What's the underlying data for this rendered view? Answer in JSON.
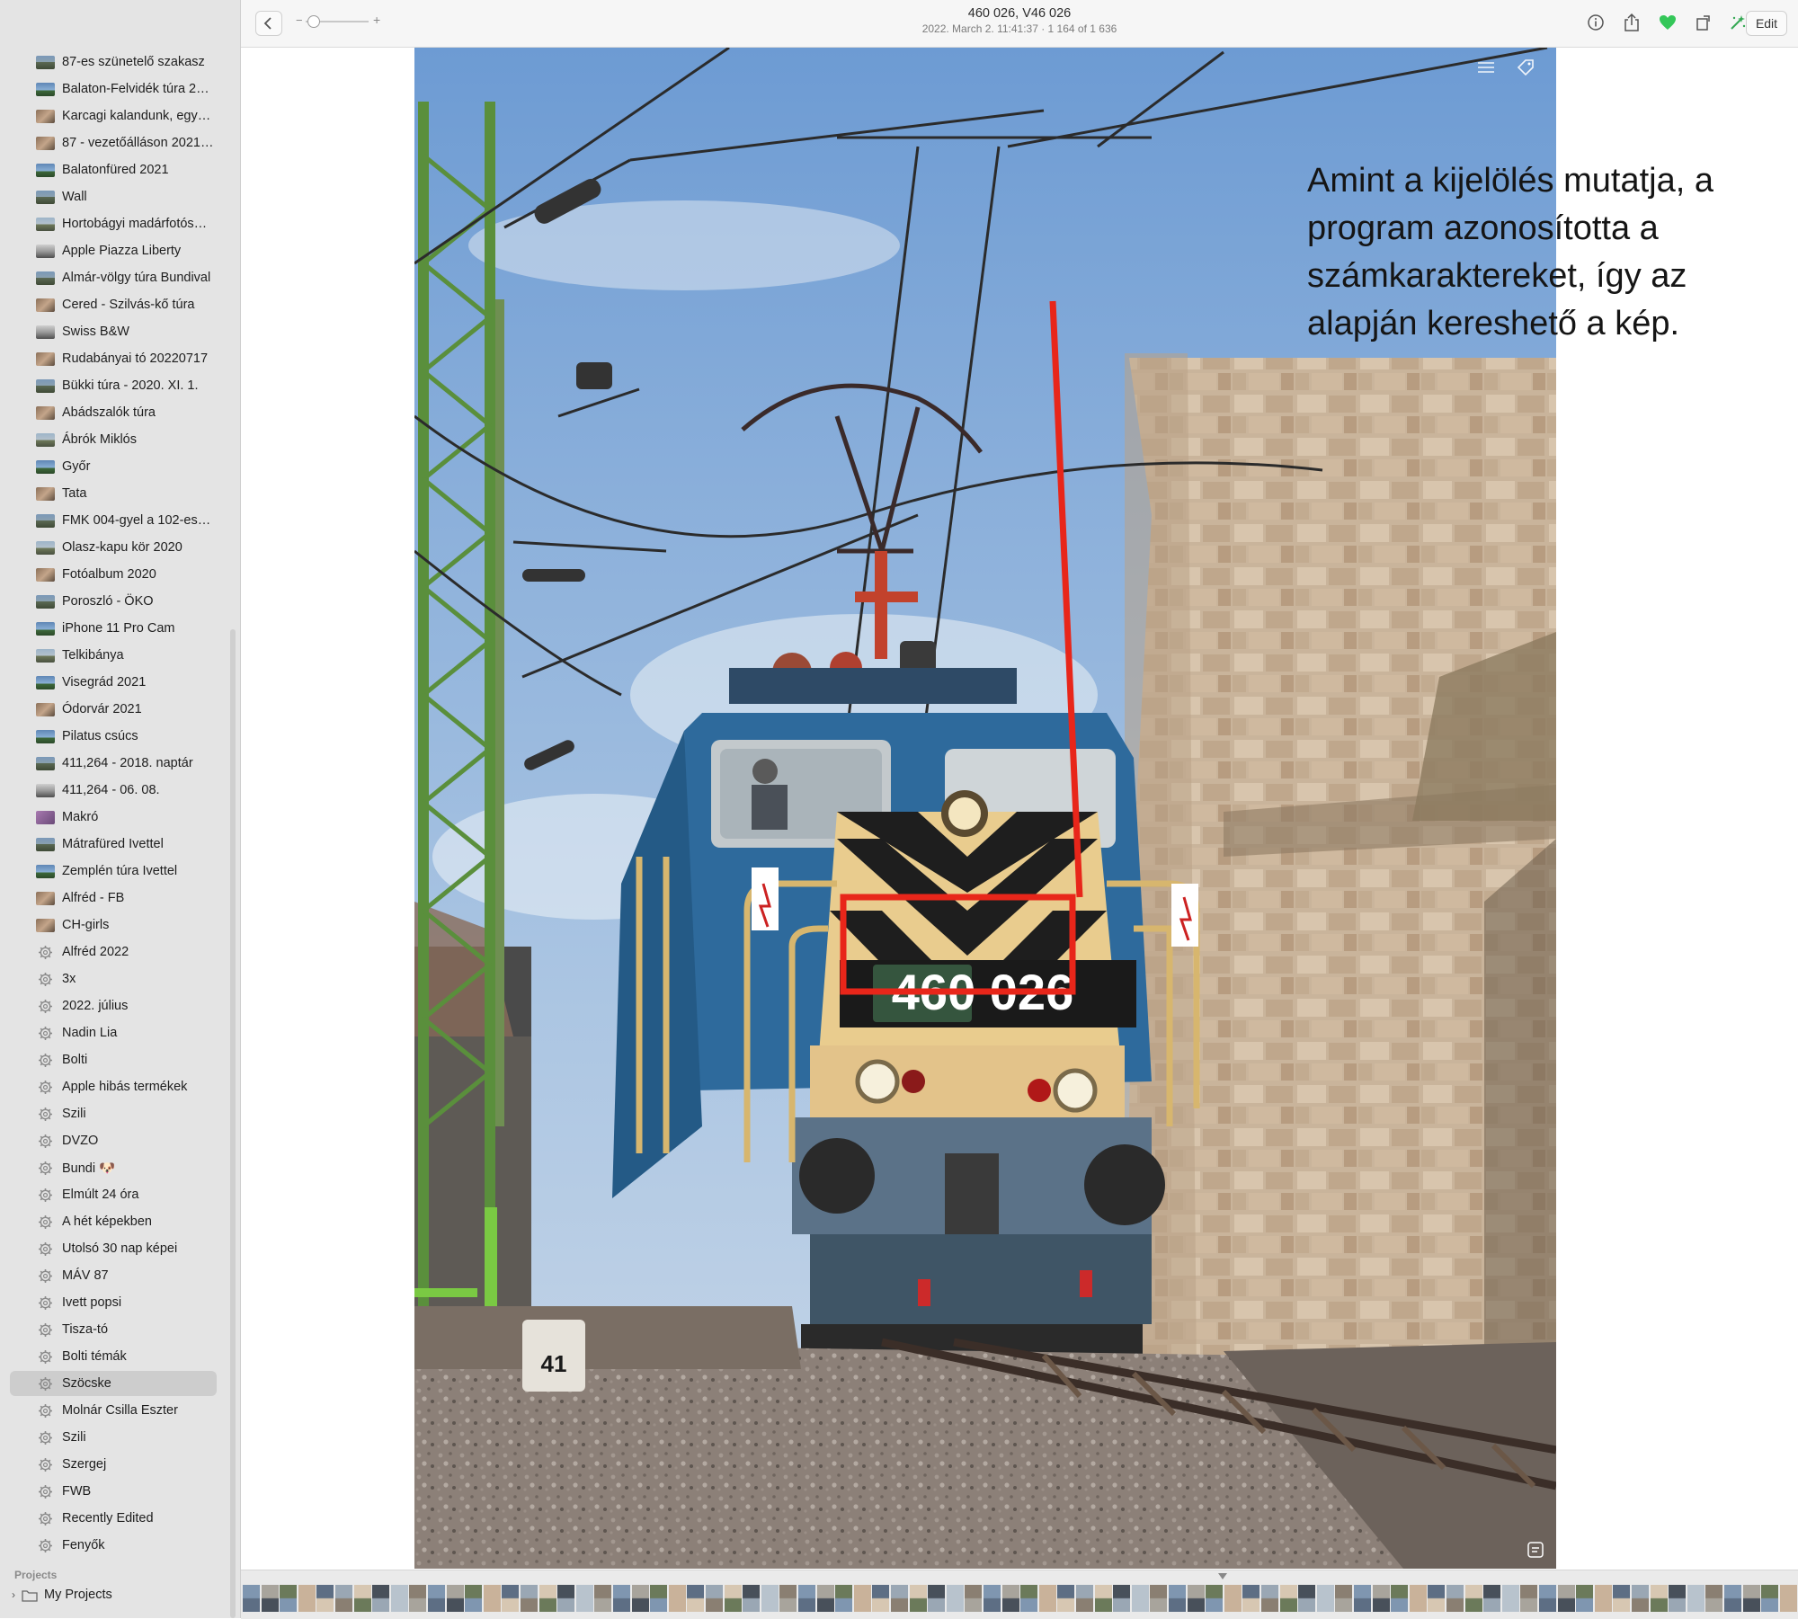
{
  "sidebar": {
    "items": [
      {
        "label": "87-es szünetelő szakasz",
        "icon": "album-thumbnail",
        "kind": "t1"
      },
      {
        "label": "Balaton-Felvidék túra 2…",
        "icon": "album-thumbnail",
        "kind": "t4"
      },
      {
        "label": "Karcagi kalandunk, egy…",
        "icon": "album-thumbnail",
        "kind": "t3"
      },
      {
        "label": "87 - vezetőálláson 2021…",
        "icon": "album-thumbnail",
        "kind": "t3"
      },
      {
        "label": "Balatonfüred 2021",
        "icon": "album-thumbnail",
        "kind": "t4"
      },
      {
        "label": "Wall",
        "icon": "album-thumbnail",
        "kind": "t1"
      },
      {
        "label": "Hortobágyi madárfotós…",
        "icon": "album-thumbnail",
        "kind": "t2"
      },
      {
        "label": "Apple Piazza Liberty",
        "icon": "album-thumbnail",
        "kind": "t5"
      },
      {
        "label": "Almár-völgy túra Bundival",
        "icon": "album-thumbnail",
        "kind": "t1"
      },
      {
        "label": "Cered - Szilvás-kő túra",
        "icon": "album-thumbnail",
        "kind": "t3"
      },
      {
        "label": "Swiss B&W",
        "icon": "album-thumbnail",
        "kind": "t5"
      },
      {
        "label": "Rudabányai tó 20220717",
        "icon": "album-thumbnail",
        "kind": "t3"
      },
      {
        "label": "Bükki túra - 2020. XI. 1.",
        "icon": "album-thumbnail",
        "kind": "t1"
      },
      {
        "label": "Abádszalók túra",
        "icon": "album-thumbnail",
        "kind": "t3"
      },
      {
        "label": "Ábrók Miklós",
        "icon": "album-thumbnail",
        "kind": "t2"
      },
      {
        "label": "Győr",
        "icon": "album-thumbnail",
        "kind": "t4"
      },
      {
        "label": "Tata",
        "icon": "album-thumbnail",
        "kind": "t3"
      },
      {
        "label": "FMK 004-gyel a 102-es…",
        "icon": "album-thumbnail",
        "kind": "t1"
      },
      {
        "label": "Olasz-kapu kör 2020",
        "icon": "album-thumbnail",
        "kind": "t2"
      },
      {
        "label": "Fotóalbum 2020",
        "icon": "album-thumbnail",
        "kind": "t3"
      },
      {
        "label": "Poroszló - ÖKO",
        "icon": "album-thumbnail",
        "kind": "t1"
      },
      {
        "label": "iPhone 11 Pro Cam",
        "icon": "album-thumbnail",
        "kind": "t4"
      },
      {
        "label": "Telkibánya",
        "icon": "album-thumbnail",
        "kind": "t2"
      },
      {
        "label": "Visegrád 2021",
        "icon": "album-thumbnail",
        "kind": "t4"
      },
      {
        "label": "Ódorvár 2021",
        "icon": "album-thumbnail",
        "kind": "t3"
      },
      {
        "label": "Pilatus csúcs",
        "icon": "album-thumbnail",
        "kind": "t4"
      },
      {
        "label": "411,264 - 2018. naptár",
        "icon": "album-thumbnail",
        "kind": "t1"
      },
      {
        "label": "411,264 - 06. 08.",
        "icon": "album-thumbnail",
        "kind": "t5"
      },
      {
        "label": "Makró",
        "icon": "album-thumbnail",
        "kind": "t6"
      },
      {
        "label": "Mátrafüred Ivettel",
        "icon": "album-thumbnail",
        "kind": "t1"
      },
      {
        "label": "Zemplén túra Ivettel",
        "icon": "album-thumbnail",
        "kind": "t4"
      },
      {
        "label": "Alfréd - FB",
        "icon": "album-thumbnail",
        "kind": "t3"
      },
      {
        "label": "CH-girls",
        "icon": "album-thumbnail",
        "kind": "t3"
      },
      {
        "label": "Alfréd 2022",
        "icon": "smart-album-gear-icon",
        "kind": "gear"
      },
      {
        "label": "3x",
        "icon": "smart-album-gear-icon",
        "kind": "gear"
      },
      {
        "label": "2022. július",
        "icon": "smart-album-gear-icon",
        "kind": "gear"
      },
      {
        "label": "Nadin Lia",
        "icon": "smart-album-gear-icon",
        "kind": "gear"
      },
      {
        "label": "Bolti",
        "icon": "smart-album-gear-icon",
        "kind": "gear"
      },
      {
        "label": "Apple hibás termékek",
        "icon": "smart-album-gear-icon",
        "kind": "gear"
      },
      {
        "label": "Szili",
        "icon": "smart-album-gear-icon",
        "kind": "gear"
      },
      {
        "label": "DVZO",
        "icon": "smart-album-gear-icon",
        "kind": "gear"
      },
      {
        "label": "Bundi 🐶",
        "icon": "smart-album-gear-icon",
        "kind": "gear"
      },
      {
        "label": "Elmúlt 24 óra",
        "icon": "smart-album-gear-icon",
        "kind": "gear"
      },
      {
        "label": "A hét képekben",
        "icon": "smart-album-gear-icon",
        "kind": "gear"
      },
      {
        "label": "Utolsó 30 nap képei",
        "icon": "smart-album-gear-icon",
        "kind": "gear"
      },
      {
        "label": "MÁV 87",
        "icon": "smart-album-gear-icon",
        "kind": "gear"
      },
      {
        "label": "Ivett popsi",
        "icon": "smart-album-gear-icon",
        "kind": "gear"
      },
      {
        "label": "Tisza-tó",
        "icon": "smart-album-gear-icon",
        "kind": "gear"
      },
      {
        "label": "Bolti témák",
        "icon": "smart-album-gear-icon",
        "kind": "gear"
      },
      {
        "label": "Szöcske",
        "icon": "smart-album-gear-icon",
        "kind": "gear",
        "selected": true
      },
      {
        "label": "Molnár Csilla Eszter",
        "icon": "smart-album-gear-icon",
        "kind": "gear"
      },
      {
        "label": "Szili",
        "icon": "smart-album-gear-icon",
        "kind": "gear"
      },
      {
        "label": "Szergej",
        "icon": "smart-album-gear-icon",
        "kind": "gear"
      },
      {
        "label": "FWB",
        "icon": "smart-album-gear-icon",
        "kind": "gear"
      },
      {
        "label": "Recently Edited",
        "icon": "smart-album-gear-icon",
        "kind": "gear"
      },
      {
        "label": "Fenyők",
        "icon": "smart-album-gear-icon",
        "kind": "gear"
      }
    ],
    "section_projects": "Projects",
    "my_projects": "My Projects"
  },
  "toolbar": {
    "title": "460 026, V46 026",
    "subtitle": "2022. March 2. 11:41:37  ·  1 164 of 1 636",
    "zoom_minus": "−",
    "zoom_plus": "+",
    "edit_label": "Edit",
    "icons": [
      "back-icon",
      "info-icon",
      "share-icon",
      "heart-icon",
      "rotate-icon",
      "enhance-icon"
    ],
    "favorite_color": "#34c759"
  },
  "photo": {
    "plate_text": "460 026",
    "km_post": "41",
    "annotation": "Amint a kijelölés mutatja, a program azonosította a számkaraktereket, így az alapján kereshető a kép.",
    "highlight_color": "#e8261a"
  },
  "filmstrip": {
    "frame_count": 84
  }
}
